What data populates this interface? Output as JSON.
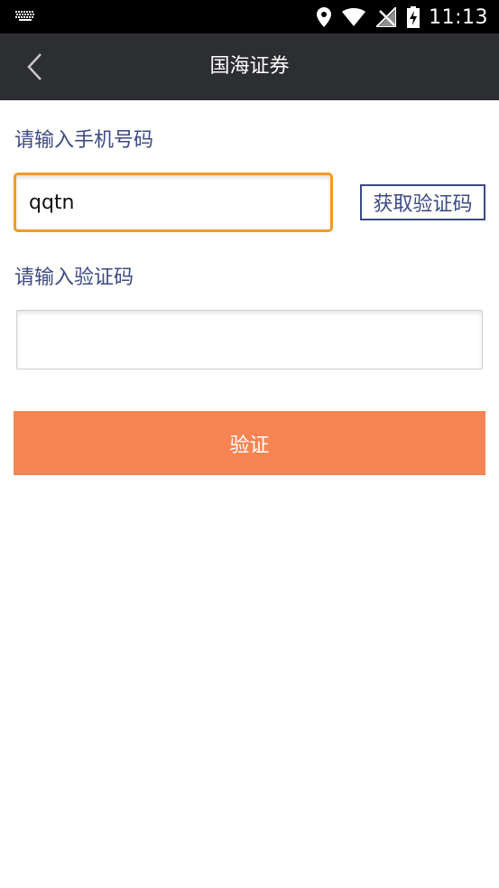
{
  "status_bar": {
    "time": "11:13",
    "icons": [
      "keyboard-icon",
      "location-icon",
      "wifi-icon",
      "no-signal-icon",
      "battery-charging-icon"
    ]
  },
  "app_bar": {
    "back_icon": "chevron-left-icon",
    "title": "国海证券"
  },
  "form": {
    "phone_label": "请输入手机号码",
    "phone_value": "qqtn",
    "get_code_label": "获取验证码",
    "code_label": "请输入验证码",
    "code_value": "",
    "verify_label": "验证"
  },
  "colors": {
    "accent_orange": "#f59a23",
    "button_orange": "#f88453",
    "label_navy": "#3d4a84",
    "app_bar": "#2d2e32"
  }
}
